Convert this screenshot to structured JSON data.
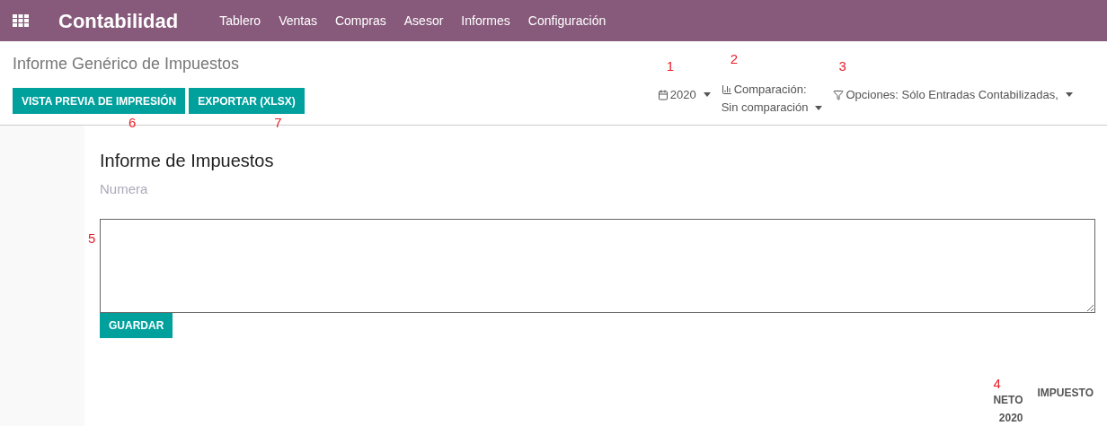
{
  "navbar": {
    "app_name": "Contabilidad",
    "menu": [
      "Tablero",
      "Ventas",
      "Compras",
      "Asesor",
      "Informes",
      "Configuración"
    ]
  },
  "control_panel": {
    "breadcrumb": "Informe Genérico de Impuestos",
    "buttons": [
      {
        "label": "VISTA PREVIA DE IMPRESIÓN",
        "annotation": "6"
      },
      {
        "label": "EXPORTAR (XLSX)",
        "annotation": "7"
      }
    ],
    "filters": [
      {
        "kind": "date",
        "label": "2020",
        "annotation": "1"
      },
      {
        "kind": "comparison",
        "label": "Comparación:",
        "value": "Sin comparación",
        "annotation": "2"
      },
      {
        "kind": "options",
        "label": "Opciones: Sólo Entradas Contabilizadas,",
        "annotation": "3"
      }
    ]
  },
  "report": {
    "title": "Informe de Impuestos",
    "subtitle": "Numera",
    "note_annotation": "5",
    "save_button": "GUARDAR",
    "columns": [
      {
        "lines": [
          "NETO",
          "2020"
        ],
        "annotation": "4"
      },
      {
        "lines": [
          "IMPUESTO"
        ]
      }
    ]
  }
}
